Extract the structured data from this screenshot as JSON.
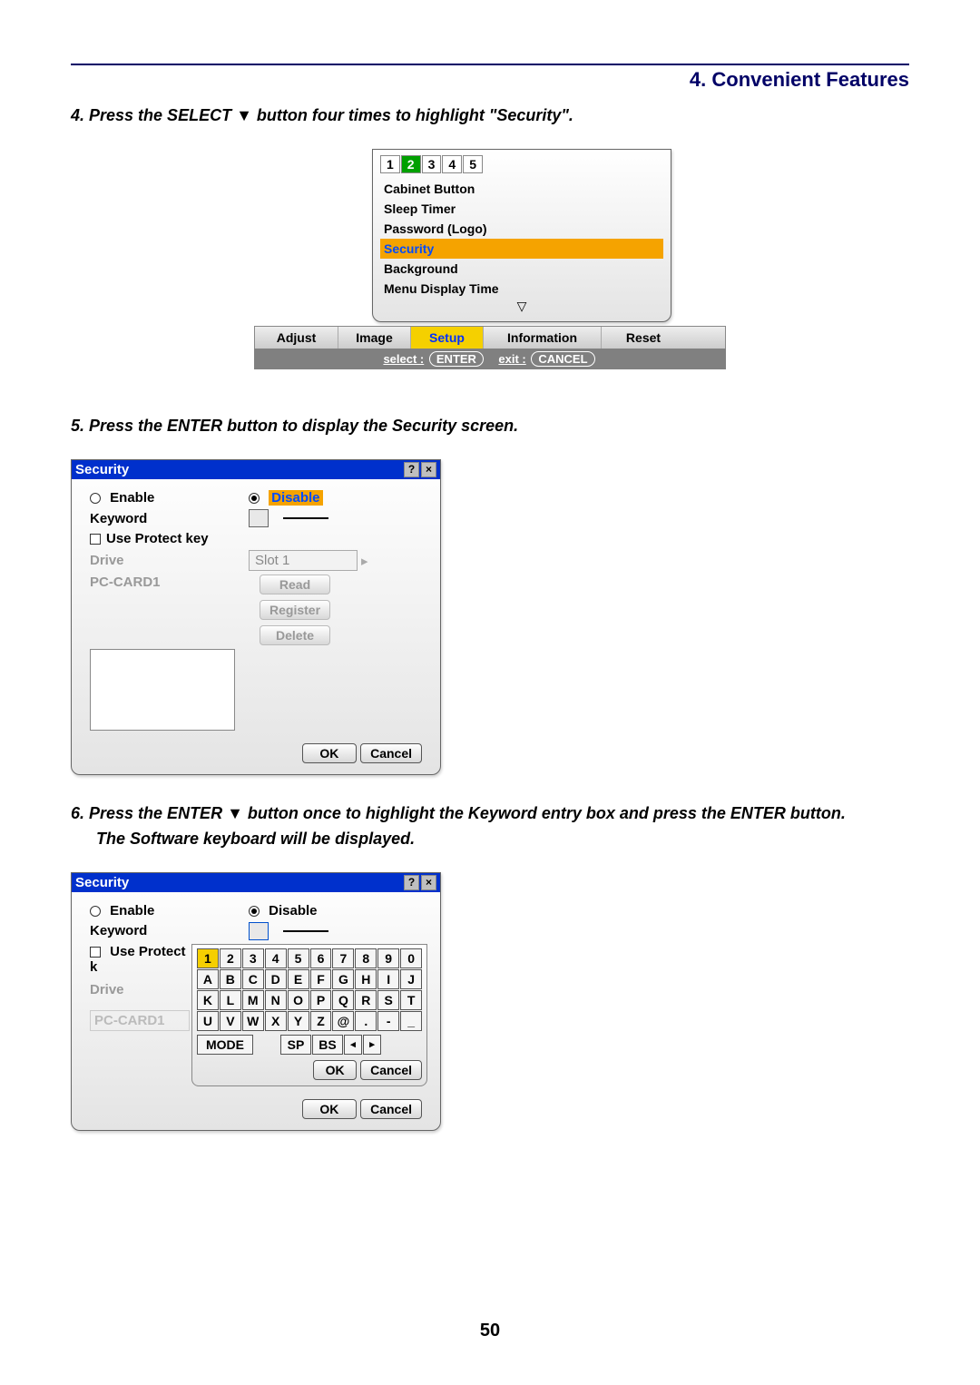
{
  "header": {
    "section": "4. Convenient Features"
  },
  "step4": "4.  Press the SELECT ▼ button four times to highlight \"Security\".",
  "step5": "5.  Press the ENTER button to display the Security screen.",
  "step6_line1": "6.  Press the ENTER ▼ button once to highlight the Keyword entry box and press the ENTER button.",
  "step6_line2": "The Software keyboard will be displayed.",
  "page_number": "50",
  "fig1": {
    "page_tabs": [
      "1",
      "2",
      "3",
      "4",
      "5"
    ],
    "page_tabs_selected_index": 1,
    "items": [
      "Cabinet Button",
      "Sleep Timer",
      "Password (Logo)",
      "Security",
      "Background",
      "Menu Display Time"
    ],
    "highlight_index": 3,
    "bottom_tabs": [
      "Adjust",
      "Image",
      "Setup",
      "Information",
      "Reset"
    ],
    "bottom_selected_index": 2,
    "hint_select_label": "select :",
    "hint_select_key": "ENTER",
    "hint_exit_label": "exit :",
    "hint_exit_key": "CANCEL"
  },
  "dlg2": {
    "title": "Security",
    "enable": "Enable",
    "disable": "Disable",
    "disable_selected": true,
    "keyword": "Keyword",
    "use_protect": "Use Protect key",
    "drive": "Drive",
    "slot": "Slot 1",
    "pc_card": "PC-CARD1",
    "btn_read": "Read",
    "btn_register": "Register",
    "btn_delete": "Delete",
    "btn_ok": "OK",
    "btn_cancel": "Cancel"
  },
  "dlg3": {
    "title": "Security",
    "enable": "Enable",
    "disable": "Disable",
    "keyword": "Keyword",
    "use_protect": "Use Protect k",
    "drive": "Drive",
    "pc_card": "PC-CARD1",
    "kbd_row1": [
      "1",
      "2",
      "3",
      "4",
      "5",
      "6",
      "7",
      "8",
      "9",
      "0"
    ],
    "kbd_row2": [
      "A",
      "B",
      "C",
      "D",
      "E",
      "F",
      "G",
      "H",
      "I",
      "J"
    ],
    "kbd_row3": [
      "K",
      "L",
      "M",
      "N",
      "O",
      "P",
      "Q",
      "R",
      "S",
      "T"
    ],
    "kbd_row4": [
      "U",
      "V",
      "W",
      "X",
      "Y",
      "Z",
      "@",
      ".",
      "-",
      "_"
    ],
    "kbd_mode": "MODE",
    "kbd_sp": "SP",
    "kbd_bs": "BS",
    "kbd_ok": "OK",
    "kbd_cancel": "Cancel",
    "btn_ok": "OK",
    "btn_cancel": "Cancel"
  }
}
